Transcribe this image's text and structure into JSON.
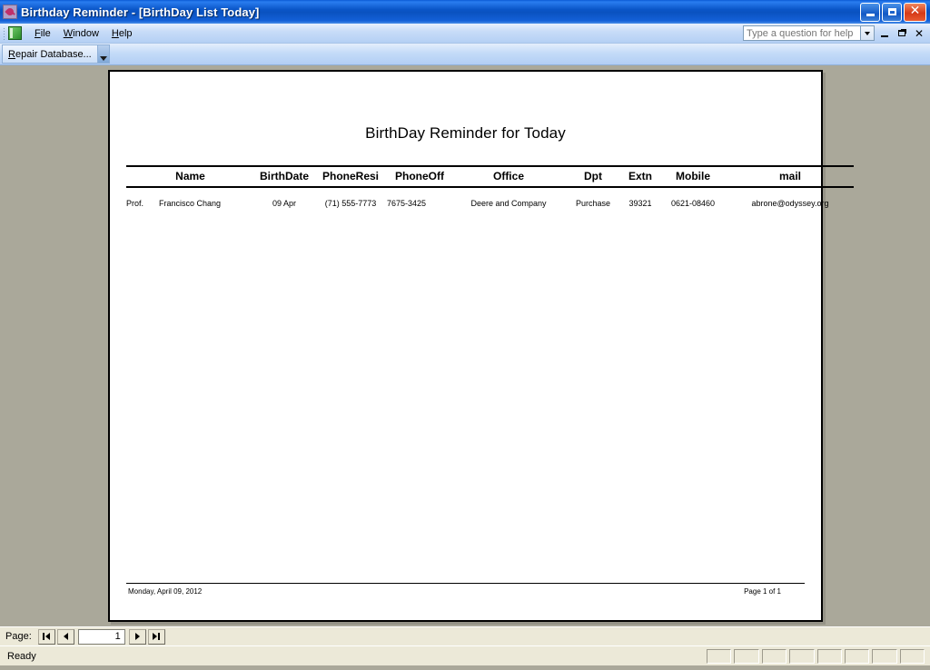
{
  "window": {
    "app_title": "Birthday Reminder",
    "separator": " - ",
    "doc_title": "[BirthDay List Today]",
    "icon": "key-icon",
    "minimize_label": "Minimize",
    "maximize_label": "Maximize",
    "close_label": "Close"
  },
  "menubar": {
    "items": [
      {
        "label": "File",
        "accel": "F"
      },
      {
        "label": "Window",
        "accel": "W"
      },
      {
        "label": "Help",
        "accel": "H"
      }
    ],
    "help_search_placeholder": "Type a question for help",
    "help_search_value": ""
  },
  "toolbar": {
    "repair_label": "Repair Database...",
    "repair_accel": "R",
    "overflow_label": "Toolbar Options"
  },
  "report": {
    "title": "BirthDay Reminder for Today",
    "columns": [
      "Name",
      "BirthDate",
      "PhoneResi",
      "PhoneOff",
      "Office",
      "Dpt",
      "Extn",
      "Mobile",
      "mail"
    ],
    "rows": [
      {
        "title": "Prof.",
        "name": "Francisco Chang",
        "birthdate": "09 Apr",
        "phoneresi": "(71) 555-7773",
        "phoneoff": "7675-3425",
        "office": "Deere and Company",
        "dpt": "Purchase",
        "extn": "39321",
        "mobile": "0621-08460",
        "mail": "abrone@odyssey.org"
      }
    ],
    "footer_date": "Monday, April 09, 2012",
    "footer_page": "Page 1 of 1"
  },
  "pagenav": {
    "label": "Page:",
    "first_label": "First Page",
    "prev_label": "Previous Page",
    "value": "1",
    "next_label": "Next Page",
    "last_label": "Last Page"
  },
  "statusbar": {
    "message": "Ready",
    "panes": [
      "",
      "",
      "",
      "",
      "",
      "",
      "",
      ""
    ]
  },
  "colors": {
    "titlebar_blue": "#0a56c8",
    "workspace_gray": "#aaa89a",
    "chrome_beige": "#ece9d8",
    "page_white": "#ffffff"
  }
}
